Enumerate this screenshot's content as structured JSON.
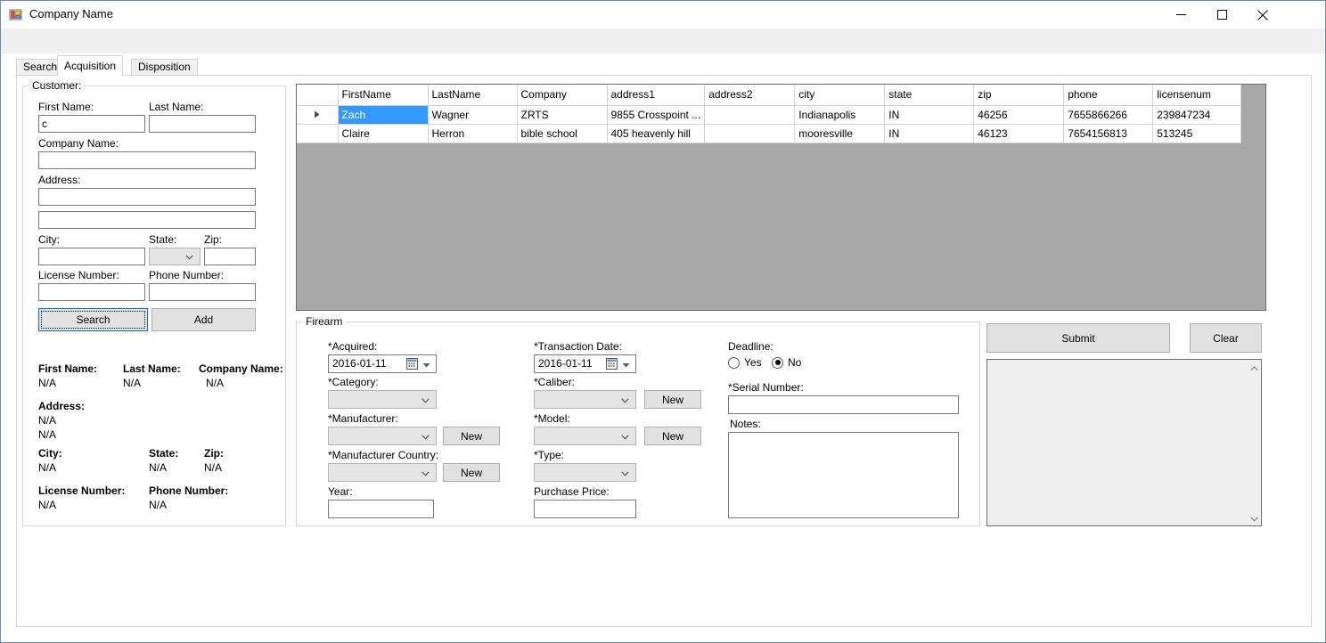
{
  "window": {
    "title": "Company Name",
    "icon": "winforms-app-icon",
    "controls": {
      "minimize": "minimize-icon",
      "maximize": "maximize-icon",
      "close": "close-icon"
    }
  },
  "tabs": [
    {
      "label": "Search",
      "active": false
    },
    {
      "label": "Acquisition",
      "active": true
    },
    {
      "label": "Disposition",
      "active": false
    }
  ],
  "customer_group": {
    "title": "Customer:",
    "labels": {
      "first_name": "First Name:",
      "last_name": "Last Name:",
      "company_name": "Company Name:",
      "address": "Address:",
      "city": "City:",
      "state": "State:",
      "zip": "Zip:",
      "license_number": "License Number:",
      "phone_number": "Phone Number:"
    },
    "values": {
      "first_name": "c",
      "last_name": "",
      "company_name": "",
      "address1": "",
      "address2": "",
      "city": "",
      "state": "",
      "zip": "",
      "license_number": "",
      "phone_number": ""
    },
    "buttons": {
      "search": "Search",
      "add": "Add"
    }
  },
  "customer_details": {
    "labels": {
      "first_name": "First Name:",
      "last_name": "Last Name:",
      "company_name": "Company Name:",
      "address": "Address:",
      "city": "City:",
      "state": "State:",
      "zip": "Zip:",
      "license_number": "License Number:",
      "phone_number": "Phone Number:"
    },
    "values": {
      "first_name": "N/A",
      "last_name": "N/A",
      "company_name": "N/A",
      "address1": "N/A",
      "address2": "N/A",
      "city": "N/A",
      "state": "N/A",
      "zip": "N/A",
      "license_number": "N/A",
      "phone_number": "N/A"
    }
  },
  "grid": {
    "columns": [
      "FirstName",
      "LastName",
      "Company",
      "address1",
      "address2",
      "city",
      "state",
      "zip",
      "phone",
      "licensenum"
    ],
    "rows": [
      {
        "selected": true,
        "marker": "row-selector-arrow",
        "cells": [
          "Zach",
          "Wagner",
          "ZRTS",
          "9855 Crosspoint ...",
          "",
          "Indianapolis",
          "IN",
          "46256",
          "7655866266",
          "239847234"
        ]
      },
      {
        "selected": false,
        "marker": "",
        "cells": [
          "Claire",
          "Herron",
          "bible school",
          "405 heavenly hill",
          "",
          "mooresville",
          "IN",
          "46123",
          "7654156813",
          "513245"
        ]
      }
    ]
  },
  "firearm_group": {
    "title": "Firearm",
    "labels": {
      "acquired": "*Acquired:",
      "category": "*Category:",
      "manufacturer": "*Manufacturer:",
      "manufacturer_country": "*Manufacturer Country:",
      "year": "Year:",
      "transaction_date": "*Transaction Date:",
      "caliber": "*Caliber:",
      "model": "*Model:",
      "type": "*Type:",
      "purchase_price": "Purchase Price:",
      "deadline": "Deadline:",
      "serial_number": "*Serial Number:",
      "notes": "Notes:"
    },
    "values": {
      "acquired": "2016-01-11",
      "category": "",
      "manufacturer": "",
      "manufacturer_country": "",
      "year": "",
      "transaction_date": "2016-01-11",
      "caliber": "",
      "model": "",
      "type": "",
      "purchase_price": "",
      "serial_number": "",
      "notes": ""
    },
    "deadline_options": [
      {
        "label": "Yes",
        "selected": false
      },
      {
        "label": "No",
        "selected": true
      }
    ],
    "new_buttons": {
      "manufacturer": "New",
      "manufacturer_country": "New",
      "caliber": "New",
      "model": "New"
    }
  },
  "actions": {
    "submit": "Submit",
    "clear": "Clear"
  },
  "output_panel": {
    "text": "",
    "scroll_up_icon": "chevron-up-icon",
    "scroll_down_icon": "chevron-down-icon"
  },
  "colors": {
    "accent": "#0078d7",
    "selection": "#3399ff",
    "grid_empty": "#a8a8a8",
    "control_face": "#f0f0f0",
    "button_face": "#e1e1e1"
  }
}
